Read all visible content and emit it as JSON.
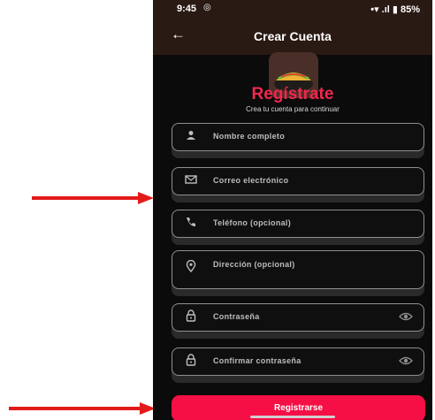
{
  "status_bar": {
    "time": "9:45",
    "icons": "•▾ .ıl ▮ 85%"
  },
  "app_bar": {
    "title": "Crear Cuenta"
  },
  "brand": {
    "title": "Regístrate",
    "subtitle": "Crea tu cuenta para continuar"
  },
  "fields": [
    {
      "icon": "person-icon",
      "label": "Nombre completo"
    },
    {
      "icon": "mail-icon",
      "label": "Correo electrónico"
    },
    {
      "icon": "phone-icon",
      "label": "Teléfono (opcional)"
    },
    {
      "icon": "location-icon",
      "label": "Dirección (opcional)"
    },
    {
      "icon": "lock-icon",
      "label": "Contraseña"
    },
    {
      "icon": "lock-icon",
      "label": "Confirmar contraseña"
    }
  ],
  "register_button": {
    "label": "Registrarse"
  },
  "colors": {
    "accent": "#f2274d",
    "button": "#f50f45",
    "annotation": "#e31a1a",
    "app_bar": "#2a1a14"
  }
}
